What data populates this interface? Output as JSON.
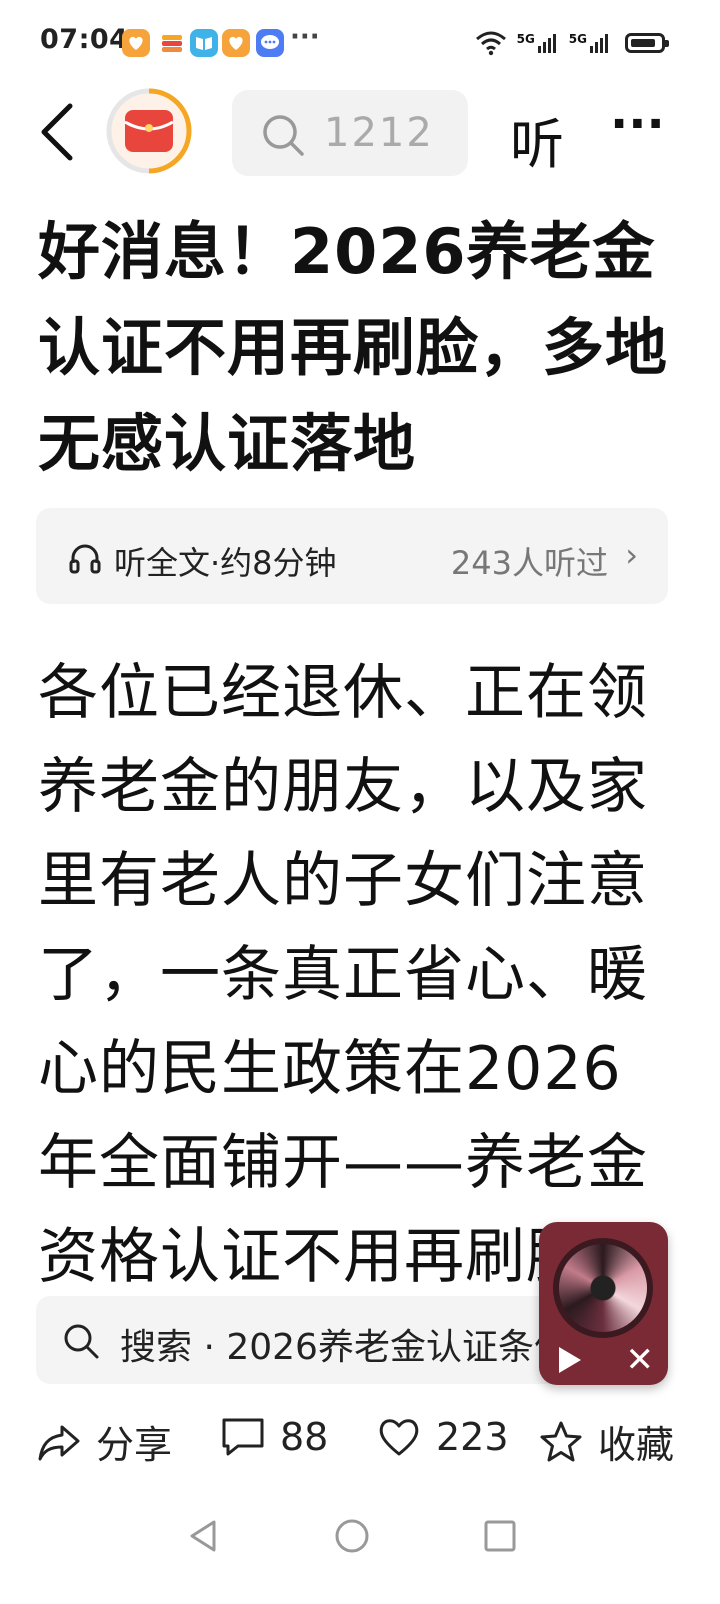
{
  "status_bar": {
    "time": "07:04",
    "more": "···",
    "network_1": "5G",
    "network_2": "5G",
    "battery_level": 0.7,
    "notification_icons": [
      "pet-app-icon",
      "wallet-app-icon",
      "book-app-icon",
      "pet-app-icon-2",
      "message-app-icon"
    ]
  },
  "nav": {
    "search_value": "1212",
    "listen_label": "听",
    "more_label": "···"
  },
  "article": {
    "title": "好消息！2026养老金认证不用再刷脸，多地无感认证落地",
    "listen_bar": {
      "label": "听全文·约8分钟",
      "count": "243人听过"
    },
    "body": "各位已经退休、正在领养老金的朋友，以及家里有老人的子女们注意了，一条真正省心、暖心的民生政策在2026年全面铺开——养老金资格认证不用再刷脸"
  },
  "search_suggestion": {
    "text": "搜索 · 2026养老金认证条件"
  },
  "actions": {
    "share": "分享",
    "comments": "88",
    "likes": "223",
    "favorite": "收藏"
  },
  "colors": {
    "accent_orange": "#f5a623",
    "avatar_red": "#e8453c",
    "player_bg": "#7a2a34"
  }
}
